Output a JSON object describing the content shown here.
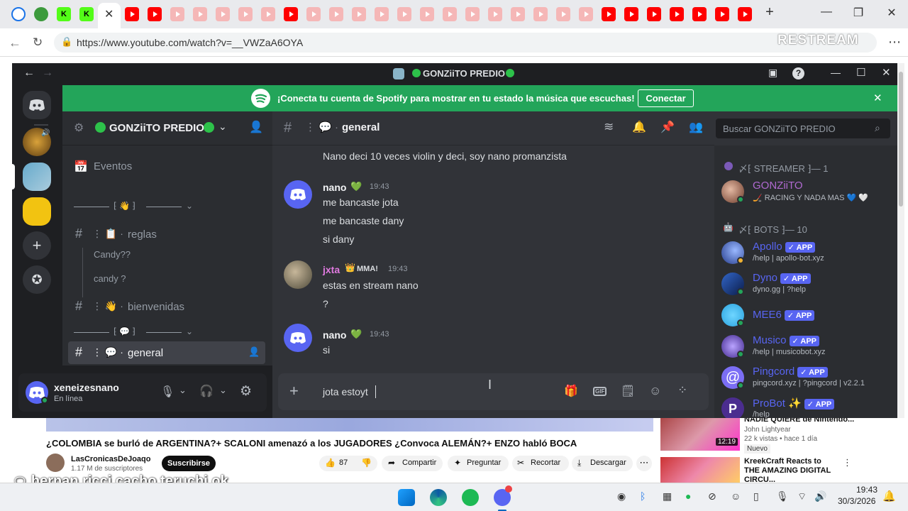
{
  "browser": {
    "url": "https://www.youtube.com/watch?v=__VWZaA6OYA",
    "watermark": "RESTREAM"
  },
  "discord": {
    "window_title": "GONZiiTO PREDIO",
    "banner": {
      "text": "¡Conecta tu cuenta de Spotify para mostrar en tu estado la música que escuchas!",
      "button": "Conectar"
    },
    "server_name": "GONZiiTO PREDIO",
    "sidebar": {
      "events": "Eventos",
      "channels": [
        {
          "name": "reglas"
        },
        {
          "name": "Candy??"
        },
        {
          "name": "candy ?"
        },
        {
          "name": "bienvenidas"
        },
        {
          "name": "general"
        }
      ]
    },
    "user": {
      "name": "xeneizesnano",
      "status": "En línea"
    },
    "chat": {
      "channel": "general",
      "first_line": "Nano deci 10 veces violin y deci, soy nano promanzista",
      "messages": [
        {
          "author": "nano",
          "time": "19:43",
          "lines": [
            "me bancaste jota",
            "me bancaste dany",
            "si dany"
          ]
        },
        {
          "author": "jxta",
          "tag": "MMA!",
          "time": "19:43",
          "lines": [
            "estas en stream nano",
            "?"
          ]
        },
        {
          "author": "nano",
          "time": "19:43",
          "lines": [
            "si"
          ]
        }
      ],
      "input_value": "jota estoyt"
    },
    "members": {
      "search_placeholder": "Buscar GONZiiTO PREDIO",
      "groups": [
        {
          "label": "STREAMER",
          "count": "— 1"
        },
        {
          "label": "BOTS",
          "count": "— 10"
        }
      ],
      "streamer": {
        "name": "GONZiiTO",
        "status": "RACING Y NADA MAS"
      },
      "bots": [
        {
          "name": "Apollo",
          "status": "/help | apollo-bot.xyz",
          "color": "#5865f2"
        },
        {
          "name": "Dyno",
          "status": "dyno.gg | ?help",
          "color": "#2a64c9"
        },
        {
          "name": "MEE6",
          "status": "",
          "color": "#36bdf2"
        },
        {
          "name": "Musico",
          "status": "/help | musicobot.xyz",
          "color": "#7b5cd6"
        },
        {
          "name": "Pingcord",
          "status": "pingcord.xyz | ?pingcord | v2.2.1",
          "color": "#6a5acd"
        },
        {
          "name": "ProBot",
          "status": "/help",
          "color": "#4b2d8f"
        }
      ],
      "app_label": "APP"
    }
  },
  "youtube": {
    "title": "¿COLOMBIA se burló de ARGENTINA?+ SCALONI amenazó a los JUGADORES ¿Convoca ALEMÁN?+ ENZO habló BOCA",
    "channel": "LasCronicasDeJoaqo",
    "subs": "1.17 M de suscriptores",
    "subscribe": "Suscribirse",
    "likes": "87",
    "actions": [
      "Compartir",
      "Preguntar",
      "Recortar",
      "Descargar"
    ],
    "rec": [
      {
        "title": "NADIE QUIERE de Nintendo...",
        "channel": "John Lightyear",
        "meta": "22 k vistas • hace 1 día",
        "badge": "Nuevo",
        "duration": "12:19"
      },
      {
        "title": "KreekCraft Reacts to THE AMAZING DIGITAL CIRCU...",
        "channel": "",
        "meta": "",
        "badge": "",
        "duration": ""
      }
    ]
  },
  "overlay_text": "hernan ricci cacho teruchi ok",
  "taskbar": {
    "time": "19:43",
    "date": "30/3/2026"
  }
}
